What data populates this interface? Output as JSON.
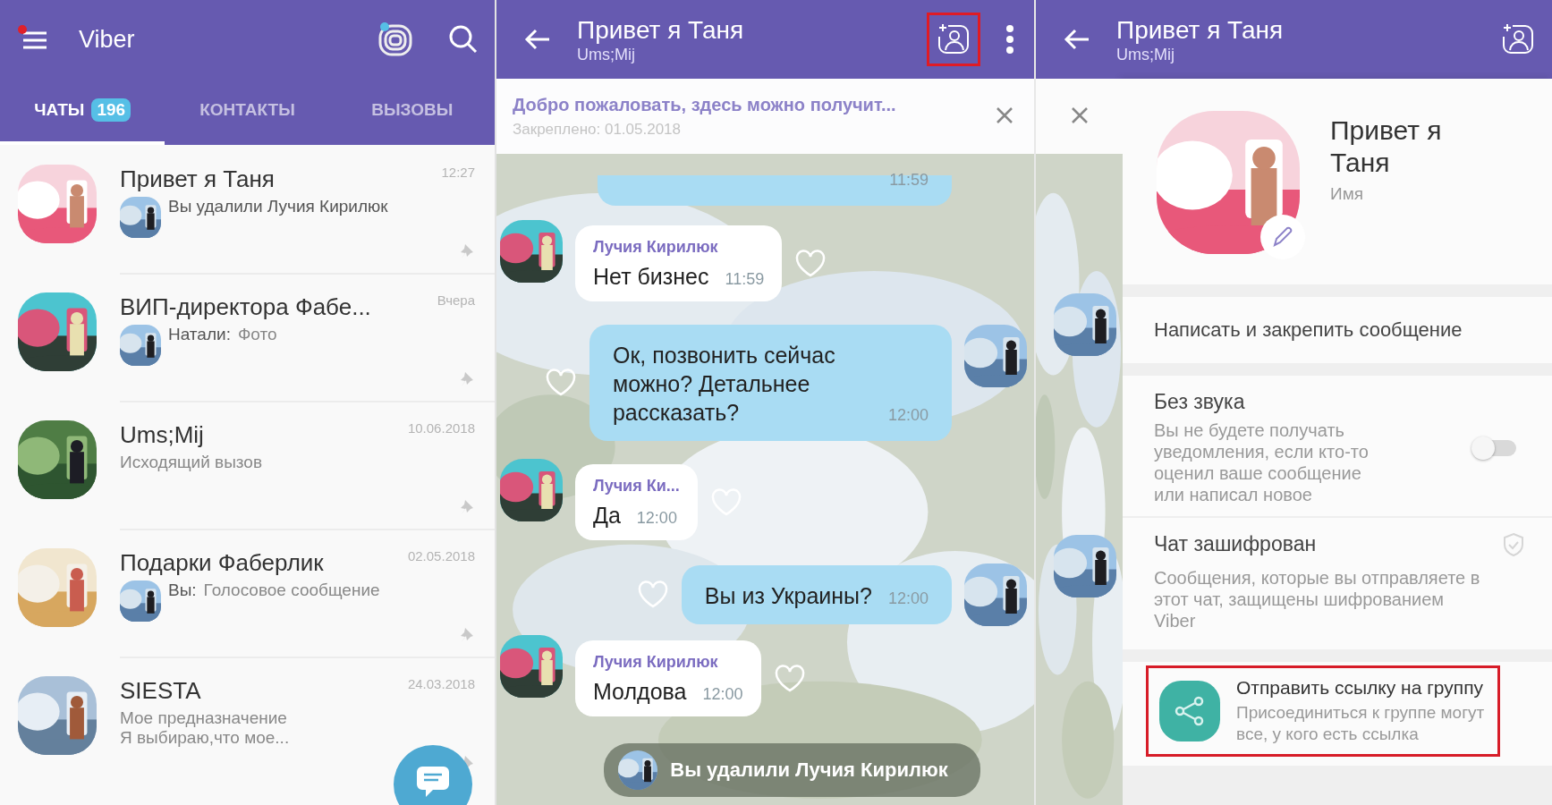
{
  "chats_screen": {
    "title": "Viber",
    "tabs": [
      {
        "label": "ЧАТЫ",
        "count": "196",
        "selected": true
      },
      {
        "label": "КОНТАКТЫ",
        "selected": false
      },
      {
        "label": "ВЫЗОВЫ",
        "selected": false
      }
    ],
    "chats": [
      {
        "name": "Привет я Таня",
        "time": "12:27",
        "kind": "event",
        "preview": "Вы удалили Лучия Кирилюк",
        "pinned": true
      },
      {
        "name": "ВИП-директора Фабе...",
        "time": "Вчера",
        "kind": "message",
        "sender": "Натали:",
        "preview": "Фото",
        "pinned": true
      },
      {
        "name": "Ums;Mij",
        "time": "10.06.2018",
        "kind": "plain",
        "lines": [
          "Исходящий вызов"
        ],
        "pinned": true
      },
      {
        "name": "Подарки Фаберлик",
        "time": "02.05.2018",
        "kind": "message",
        "sender": "Вы:",
        "preview": "Голосовое сообщение",
        "pinned": true
      },
      {
        "name": "SIESTA",
        "time": "24.03.2018",
        "kind": "plain",
        "lines": [
          "Мое предназначение",
          "Я выбираю,что мое..."
        ],
        "pinned": true
      }
    ]
  },
  "chat_screen": {
    "title": "Привет я Таня",
    "subtitle": "Ums;Mij",
    "add_contact": {
      "highlighted": true
    },
    "pinned_message": {
      "text": "Добро пожаловать, здесь можно получит...",
      "meta": "Закреплено: 01.05.2018"
    },
    "messages": [
      {
        "kind": "out",
        "time": "11:59"
      },
      {
        "kind": "in",
        "sender": "Лучия Кирилюк",
        "text": "Нет бизнес",
        "time": "11:59"
      },
      {
        "kind": "out",
        "text": "Ок, позвонить сейчас можно? Детальнее рассказать?",
        "time": "12:00"
      },
      {
        "kind": "in",
        "sender": "Лучия Ки...",
        "text": "Да",
        "time": "12:00"
      },
      {
        "kind": "out",
        "text": "Вы из Украины?",
        "time": "12:00"
      },
      {
        "kind": "in",
        "sender": "Лучия Кирилюк",
        "text": "Молдова",
        "time": "12:00"
      },
      {
        "kind": "event",
        "text": "Вы удалили Лучия Кирилюк"
      }
    ]
  },
  "info_screen": {
    "title": "Привет я Таня",
    "subtitle": "Ums;Mij",
    "add_contact": {
      "highlighted": false
    },
    "name": "Привет я Таня",
    "name_label": "Имя",
    "pin_action": "Написать и закрепить сообщение",
    "mute": {
      "title": "Без звука",
      "description": "Вы не будете получать уведомления, если кто-то оценил ваше сообщение или написал новое",
      "on": false
    },
    "encryption": {
      "title": "Чат зашифрован",
      "description": "Сообщения, которые вы отправляете в этот чат, защищены шифрованием Viber"
    },
    "share_link": {
      "title": "Отправить ссылку на группу",
      "description": "Присоединиться к группе могут все, у кого есть ссылка",
      "highlighted": true
    }
  }
}
